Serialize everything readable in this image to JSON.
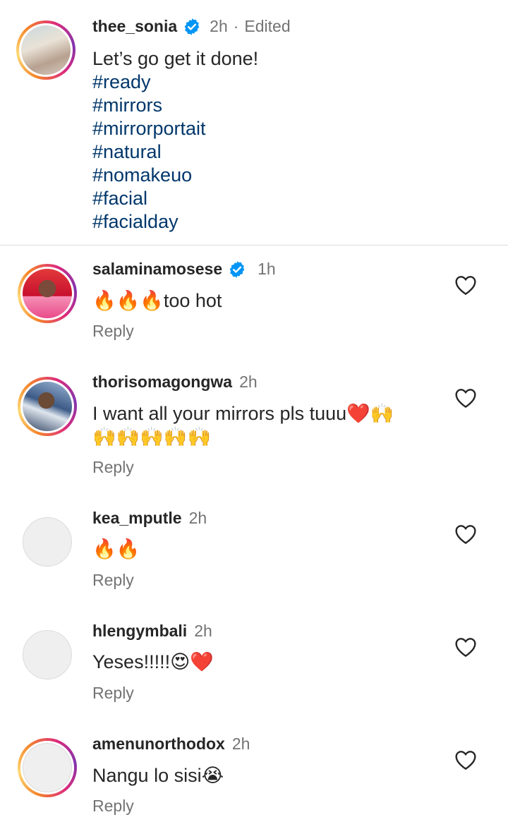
{
  "caption": {
    "username": "thee_sonia",
    "time": "2h",
    "separator": "·",
    "edited": "Edited",
    "text": "Let’s go get it done!",
    "hashtags": [
      "#ready",
      "#mirrors",
      "#mirrorportait",
      "#natural",
      "#nomakeuo",
      "#facial",
      "#facialday"
    ]
  },
  "comments": [
    {
      "username": "salaminamosese",
      "verified": true,
      "time": "1h",
      "emoji_prefix": "🔥🔥🔥",
      "text": "too hot",
      "reply": "Reply"
    },
    {
      "username": "thorisomagongwa",
      "verified": false,
      "time": "2h",
      "text": "I want all your mirrors pls tuuu❤️🙌",
      "text_line2": "🙌🙌🙌🙌🙌",
      "reply": "Reply"
    },
    {
      "username": "kea_mputle",
      "verified": false,
      "time": "2h",
      "text": "🔥🔥",
      "reply": "Reply"
    },
    {
      "username": "hlengymbali",
      "verified": false,
      "time": "2h",
      "text": "Yeses!!!!!😍❤️",
      "reply": "Reply"
    },
    {
      "username": "amenunorthodox",
      "verified": false,
      "time": "2h",
      "text": "Nangu lo sisi😭",
      "reply": "Reply"
    }
  ],
  "icons": {
    "verified": "verified-badge-icon",
    "like": "heart-outline-icon"
  },
  "colors": {
    "hashtag": "#00376b",
    "verified": "#0095f6",
    "secondary_text": "#737373"
  }
}
